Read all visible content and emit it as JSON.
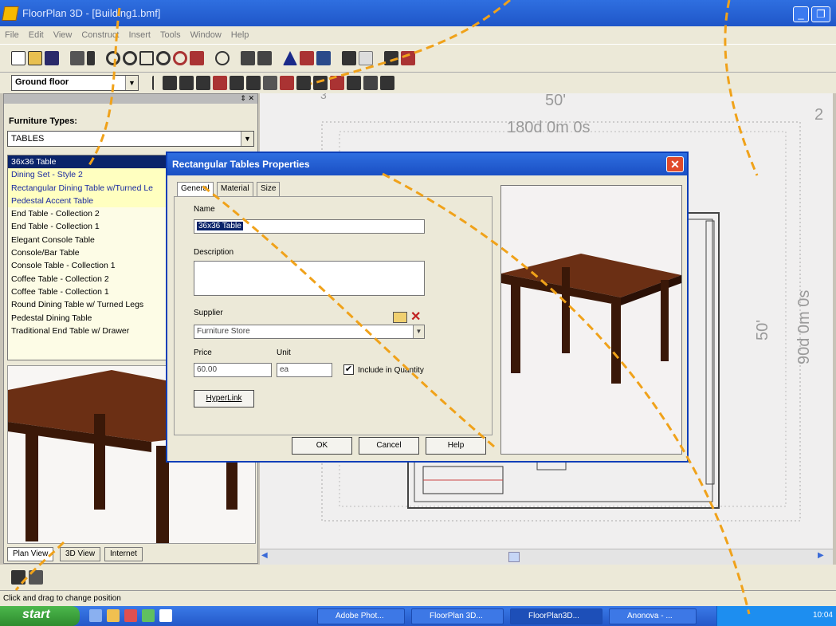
{
  "window": {
    "title": "FloorPlan 3D - [Building1.bmf]"
  },
  "menu": [
    "File",
    "Edit",
    "View",
    "Construct",
    "Insert",
    "Tools",
    "Window",
    "Help"
  ],
  "floor_select": {
    "value": "Ground floor"
  },
  "left_panel": {
    "furniture_types_label": "Furniture Types:",
    "furniture_types_value": "TABLES",
    "items": [
      "36x36 Table",
      "Dining Set - Style 2",
      "Rectangular Dining Table w/Turned Le",
      "Pedestal Accent Table",
      "End Table - Collection 2",
      "End Table - Collection 1",
      "Elegant Console Table",
      "Console/Bar Table",
      "Console Table - Collection 1",
      "Coffee Table - Collection 2",
      "Coffee Table - Collection 1",
      "Round Dining Table w/ Turned Legs",
      "Pedestal Dining Table",
      "Traditional End Table w/ Drawer"
    ],
    "tabs": [
      "Plan View",
      "3D View",
      "Internet"
    ]
  },
  "canvas": {
    "dim_top": "50'",
    "angle_top": "180d 0m 0s",
    "dim_right": "50'",
    "angle_right": "90d 0m 0s",
    "corner_label": "2",
    "corner_label_left": "3"
  },
  "dialog": {
    "title": "Rectangular Tables Properties",
    "tabs": [
      "General",
      "Material",
      "Size"
    ],
    "name_label": "Name",
    "name_value": "36x36 Table",
    "description_label": "Description",
    "supplier_label": "Supplier",
    "supplier_value": "Furniture Store",
    "price_label": "Price",
    "price_value": "60.00",
    "unit_label": "Unit",
    "unit_value": "ea",
    "include_label": "Include in Quantity",
    "include_checked": true,
    "hyperlink_label": "HyperLink",
    "ok_label": "OK",
    "cancel_label": "Cancel",
    "help_label": "Help"
  },
  "status": {
    "text": "Click and drag to change position"
  },
  "taskbar": {
    "start_label": "start",
    "tasks": [
      "Adobe Phot...",
      "FloorPlan 3D...",
      "FloorPlan3D...",
      "Anonova - ..."
    ],
    "clock": "10:04"
  },
  "colors": {
    "titlebar": "#1f56c8",
    "selection": "#0a246a",
    "dialog_close": "#e04a2a",
    "annotation_dash": "#f0a21a",
    "table_top": "#6b2f14"
  }
}
